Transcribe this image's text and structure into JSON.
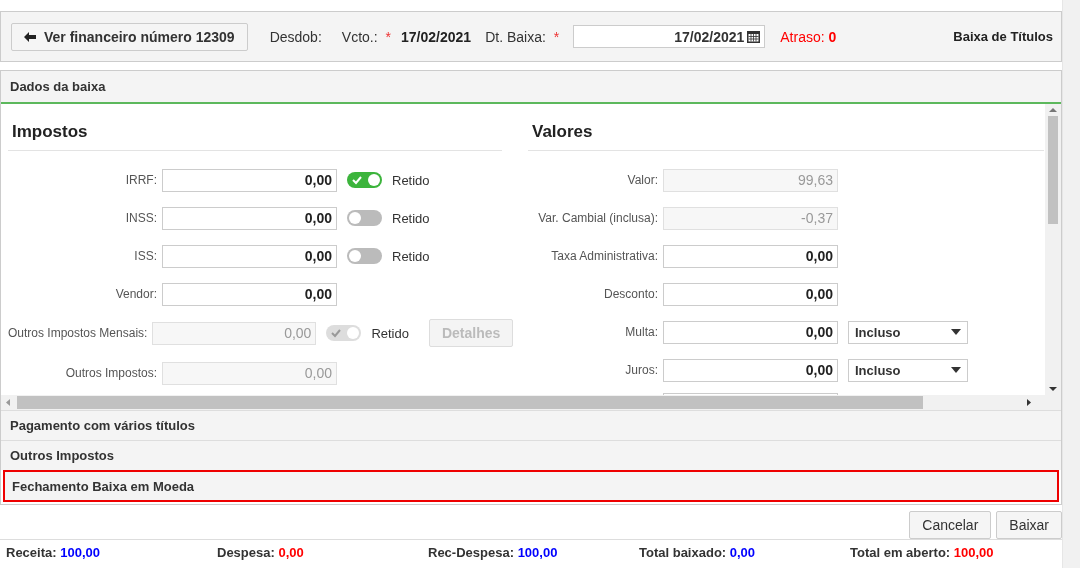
{
  "toolbar": {
    "back_button": "Ver financeiro número 12309",
    "desdob_label": "Desdob:",
    "vcto": {
      "label": "Vcto.:",
      "mark": "*",
      "value": "17/02/2021"
    },
    "baixa": {
      "label": "Dt. Baixa:",
      "mark": "*",
      "value": "17/02/2021"
    },
    "atraso": {
      "label": "Atraso:",
      "value": "0"
    },
    "title": "Baixa de Títulos"
  },
  "panel": {
    "title": "Dados da baixa",
    "impostos": {
      "title": "Impostos",
      "rows": [
        {
          "label": "IRRF:",
          "value": "0,00",
          "disabled": false,
          "toggle": {
            "on": true,
            "disabled": false,
            "label": "Retido"
          }
        },
        {
          "label": "INSS:",
          "value": "0,00",
          "disabled": false,
          "toggle": {
            "on": false,
            "disabled": false,
            "label": "Retido"
          }
        },
        {
          "label": "ISS:",
          "value": "0,00",
          "disabled": false,
          "toggle": {
            "on": false,
            "disabled": false,
            "label": "Retido"
          }
        },
        {
          "label": "Vendor:",
          "value": "0,00",
          "disabled": false
        },
        {
          "label": "Outros Impostos Mensais:",
          "value": "0,00",
          "disabled": true,
          "toggle": {
            "on": true,
            "disabled": true,
            "label": "Retido"
          },
          "button": {
            "label": "Detalhes",
            "disabled": true
          }
        },
        {
          "label": "Outros Impostos:",
          "value": "0,00",
          "disabled": true
        }
      ]
    },
    "valores": {
      "title": "Valores",
      "rows": [
        {
          "label": "Valor:",
          "value": "99,63",
          "disabled": true
        },
        {
          "label": "Var. Cambial (inclusa):",
          "value": "-0,37",
          "disabled": true
        },
        {
          "label": "Taxa Administrativa:",
          "value": "0,00",
          "disabled": false
        },
        {
          "label": "Desconto:",
          "value": "0,00",
          "disabled": false
        },
        {
          "label": "Multa:",
          "value": "0,00",
          "disabled": false,
          "select": "Incluso"
        },
        {
          "label": "Juros:",
          "value": "0,00",
          "disabled": false,
          "select": "Incluso"
        }
      ]
    }
  },
  "sections": [
    {
      "title": "Pagamento com vários títulos",
      "highlighted": false
    },
    {
      "title": "Outros Impostos",
      "highlighted": false
    },
    {
      "title": "Fechamento Baixa em Moeda",
      "highlighted": true
    }
  ],
  "buttons": [
    "Cancelar",
    "Baixar"
  ],
  "status_bar": [
    {
      "label": "Receita:",
      "value": "100,00",
      "color": "#0000ff"
    },
    {
      "label": "Despesa:",
      "value": "0,00",
      "color": "#ff0000"
    },
    {
      "label": "Rec-Despesa:",
      "value": "100,00",
      "color": "#0000ff"
    },
    {
      "label": "Total baixado:",
      "value": "0,00",
      "color": "#0000ff"
    },
    {
      "label": "Total em aberto:",
      "value": "100,00",
      "color": "#ff0000"
    }
  ]
}
